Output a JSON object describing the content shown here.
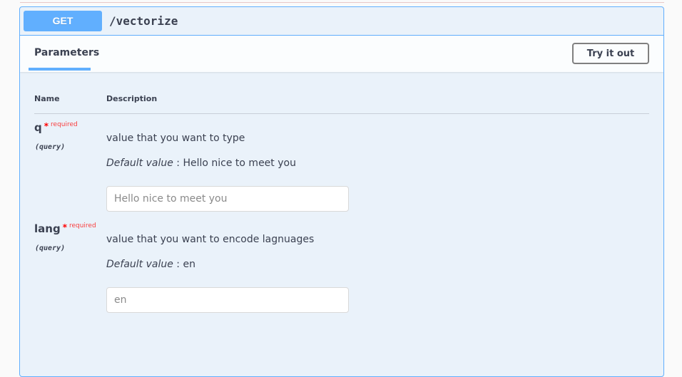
{
  "operation": {
    "method": "GET",
    "path": "/vectorize"
  },
  "section": {
    "tab_label": "Parameters",
    "try_button": "Try it out"
  },
  "table": {
    "col_name": "Name",
    "col_description": "Description"
  },
  "required_star": "*",
  "required_label": "required",
  "default_label": "Default value",
  "default_sep": " : ",
  "params": [
    {
      "name": "q",
      "in": "(query)",
      "description": "value that you want to type",
      "default": "Hello nice to meet you",
      "placeholder": "Hello nice to meet you"
    },
    {
      "name": "lang",
      "in": "(query)",
      "description": "value that you want to encode lagnuages",
      "default": "en",
      "placeholder": "en"
    }
  ],
  "colors": {
    "get_blue": "#61affe",
    "required_red": "#f93e3e"
  }
}
